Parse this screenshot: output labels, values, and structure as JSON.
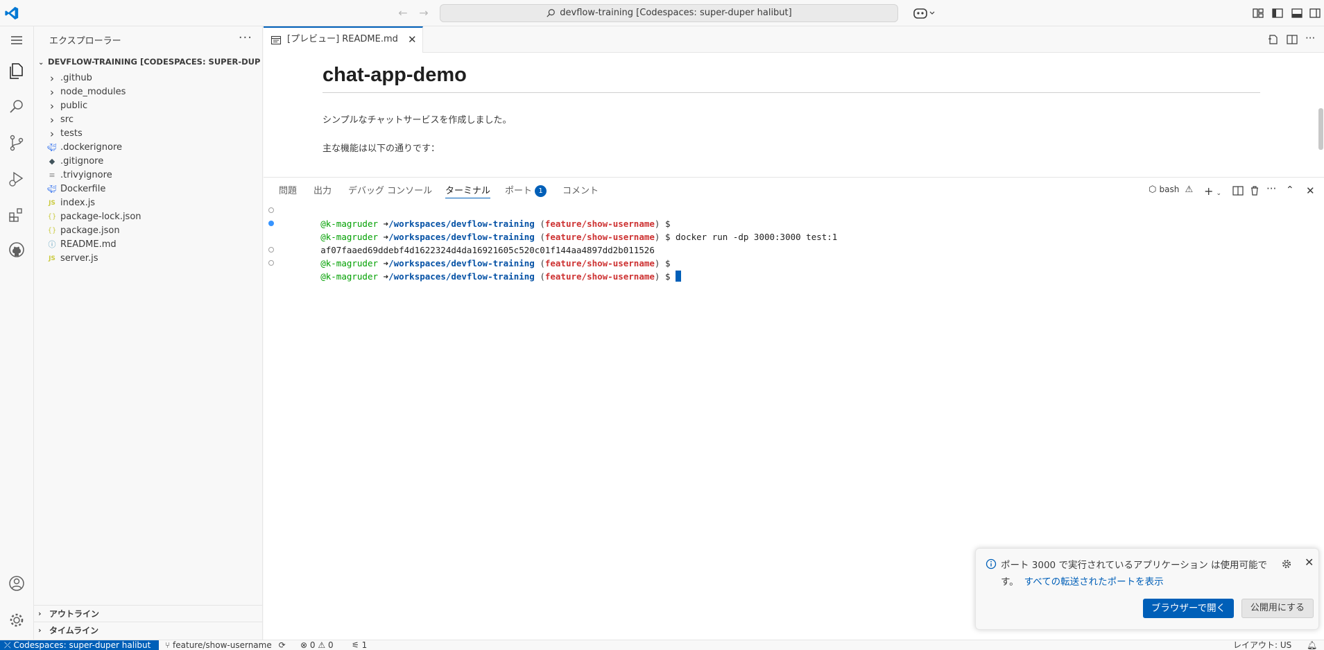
{
  "titlebar": {
    "search_text": "devflow-training [Codespaces: super-duper halibut]"
  },
  "sidebar": {
    "title": "エクスプローラー",
    "root_label": "DEVFLOW-TRAINING [CODESPACES: SUPER-DUPER ...",
    "items": [
      {
        "label": ".github",
        "type": "folder"
      },
      {
        "label": "node_modules",
        "type": "folder"
      },
      {
        "label": "public",
        "type": "folder"
      },
      {
        "label": "src",
        "type": "folder"
      },
      {
        "label": "tests",
        "type": "folder"
      },
      {
        "label": ".dockerignore",
        "type": "docker"
      },
      {
        "label": ".gitignore",
        "type": "git"
      },
      {
        "label": ".trivyignore",
        "type": "text"
      },
      {
        "label": "Dockerfile",
        "type": "docker"
      },
      {
        "label": "index.js",
        "type": "js"
      },
      {
        "label": "package-lock.json",
        "type": "json"
      },
      {
        "label": "package.json",
        "type": "json"
      },
      {
        "label": "README.md",
        "type": "info"
      },
      {
        "label": "server.js",
        "type": "js"
      }
    ],
    "outline_label": "アウトライン",
    "timeline_label": "タイムライン"
  },
  "editor": {
    "tab_label": "[プレビュー] README.md",
    "heading": "chat-app-demo",
    "paragraph1": "シンプルなチャットサービスを作成しました。",
    "paragraph2": "主な機能は以下の通りです："
  },
  "panel": {
    "tabs": [
      {
        "label": "問題"
      },
      {
        "label": "出力"
      },
      {
        "label": "デバッグ コンソール"
      },
      {
        "label": "ターミナル"
      },
      {
        "label": "ポート"
      },
      {
        "label": "コメント"
      }
    ],
    "ports_badge": "1",
    "shell_label": "bash",
    "terminal": {
      "user": "@k-magruder",
      "arrow": "➜",
      "path": "/workspaces/devflow-training",
      "branch": "feature/show-username",
      "command": "docker run -dp 3000:3000 test:1",
      "output": "af07faaed69ddebf4d1622324d4da16921605c520c01f144aa4897dd2b011526"
    }
  },
  "notification": {
    "message": "ポート 3000 で実行されているアプリケーション は使用可能です。",
    "link": "すべての転送されたポートを表示",
    "primary_button": "ブラウザーで開く",
    "secondary_button": "公開用にする"
  },
  "statusbar": {
    "remote": "Codespaces: super-duper halibut",
    "branch": "feature/show-username",
    "errors": "0",
    "warnings": "0",
    "ports": "1",
    "layout": "レイアウト: US"
  },
  "colors": {
    "accent": "#005fb8",
    "terminal_user": "#00a000",
    "terminal_path": "#0451a5",
    "terminal_branch": "#cd3131"
  }
}
